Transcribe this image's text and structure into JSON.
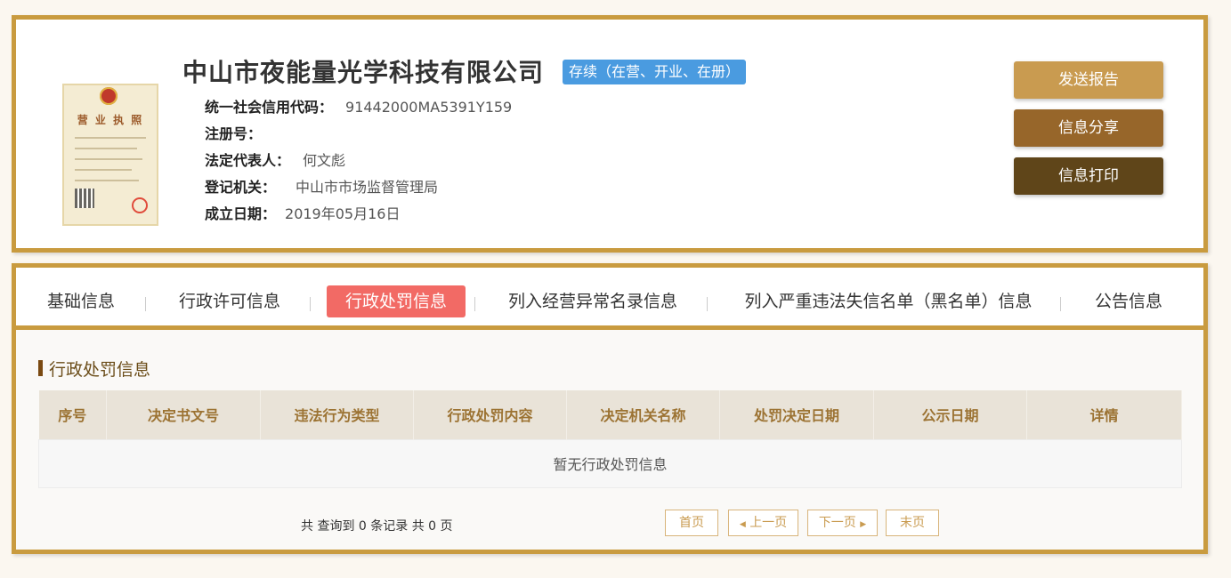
{
  "company": {
    "name": "中山市夜能量光学科技有限公司",
    "status": "存续（在营、开业、在册）",
    "license_title": "营 业 执 照"
  },
  "info": [
    {
      "label": "统一社会信用代码：",
      "value": "91442000MA5391Y159"
    },
    {
      "label": "注册号：",
      "value": ""
    },
    {
      "label": "法定代表人：",
      "value": "何文彪"
    },
    {
      "label": "登记机关：",
      "value": "中山市市场监督管理局"
    },
    {
      "label": "成立日期：",
      "value": "2019年05月16日"
    }
  ],
  "actions": {
    "send": "发送报告",
    "share": "信息分享",
    "print": "信息打印"
  },
  "tabs": [
    {
      "label": "基础信息",
      "active": false
    },
    {
      "label": "行政许可信息",
      "active": false
    },
    {
      "label": "行政处罚信息",
      "active": true
    },
    {
      "label": "列入经营异常名录信息",
      "active": false
    },
    {
      "label": "列入严重违法失信名单（黑名单）信息",
      "active": false
    },
    {
      "label": "公告信息",
      "active": false
    }
  ],
  "section": {
    "title": "行政处罚信息"
  },
  "table": {
    "headers": [
      "序号",
      "决定书文号",
      "违法行为类型",
      "行政处罚内容",
      "决定机关名称",
      "处罚决定日期",
      "公示日期",
      "详情"
    ],
    "empty_message": "暂无行政处罚信息"
  },
  "pagination": {
    "summary": "共 查询到 0 条记录 共 0 页",
    "first": "首页",
    "prev": "上一页",
    "next": "下一页",
    "last": "末页"
  },
  "colors": {
    "border": "#c99b3f",
    "active_tab": "#f26a65",
    "status_badge": "#4a9be0"
  }
}
